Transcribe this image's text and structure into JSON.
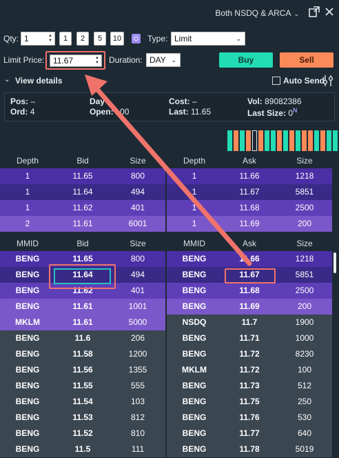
{
  "topbar": {
    "venue_label": "Both NSDQ & ARCA",
    "venue_chevron": "⌄",
    "popout_icon": "popout-icon",
    "close_icon": "close-icon"
  },
  "order": {
    "qty_label": "Qty:",
    "qty_value": "1",
    "qty_presets": [
      "1",
      "2",
      "5",
      "10"
    ],
    "o_badge": "O",
    "type_label": "Type:",
    "type_value": "Limit",
    "limit_label": "Limit Price:",
    "limit_value": "11.67",
    "duration_label": "Duration:",
    "duration_value": "DAY",
    "buy_label": "Buy",
    "sell_label": "Sell",
    "view_details_label": "View details",
    "auto_send_label": "Auto Send",
    "colors": {
      "buy": "#22dcb4",
      "sell": "#fa8a58",
      "highlight": "#f0736b",
      "focus": "#25c5c0"
    }
  },
  "stats": {
    "pos_label": "Pos:",
    "pos_value": "–",
    "ord_label": "Ord:",
    "ord_value": "4",
    "day_label": "Day",
    "day_value": "",
    "open_label": "Open:",
    "open_value": "00",
    "cost_label": "Cost:",
    "cost_value": "–",
    "last_label": "Last:",
    "last_value": "11.65",
    "vol_label": "Vol:",
    "vol_value": "89082386",
    "last_size_label": "Last Size:",
    "last_size_value": "0",
    "last_size_tag": "N"
  },
  "activity_bars": [
    "#22dcb4",
    "#fa8a58",
    "#22dcb4",
    "#fa8a58",
    "#1e2a33",
    "#fa8a58",
    "#22dcb4",
    "#22dcb4",
    "#fa8a58",
    "#22dcb4",
    "#fa8a58",
    "#22dcb4",
    "#fa8a58",
    "#fa8a58",
    "#22dcb4",
    "#fa8a58",
    "#22dcb4",
    "#22dcb4",
    "#fa8a58"
  ],
  "depth": {
    "headers": [
      "Depth",
      "Bid",
      "Size",
      "Depth",
      "Ask",
      "Size"
    ],
    "rows": [
      {
        "bid_depth": "1",
        "bid": "11.65",
        "bid_size": "800",
        "ask_depth": "1",
        "ask": "11.66",
        "ask_size": "1218",
        "color": "#4a2fa6"
      },
      {
        "bid_depth": "1",
        "bid": "11.64",
        "bid_size": "494",
        "ask_depth": "1",
        "ask": "11.67",
        "ask_size": "5851",
        "color": "#3a2a88"
      },
      {
        "bid_depth": "1",
        "bid": "11.62",
        "bid_size": "401",
        "ask_depth": "1",
        "ask": "11.68",
        "ask_size": "2500",
        "color": "#5e3fb8"
      },
      {
        "bid_depth": "2",
        "bid": "11.61",
        "bid_size": "6001",
        "ask_depth": "1",
        "ask": "11.69",
        "ask_size": "200",
        "color": "#7b58c9"
      }
    ]
  },
  "book": {
    "headers": [
      "MMID",
      "Bid",
      "Size",
      "MMID",
      "Ask",
      "Size"
    ],
    "rows": [
      {
        "bid_mmid": "BENG",
        "bid": "11.65",
        "bid_size": "800",
        "bid_color": "#4a2fa6",
        "ask_mmid": "BENG",
        "ask": "11.66",
        "ask_size": "1218",
        "ask_color": "#4a2fa6"
      },
      {
        "bid_mmid": "BENG",
        "bid": "11.64",
        "bid_size": "494",
        "bid_color": "#3a2a88",
        "ask_mmid": "BENG",
        "ask": "11.67",
        "ask_size": "5851",
        "ask_color": "#3a2a88"
      },
      {
        "bid_mmid": "BENG",
        "bid": "11.62",
        "bid_size": "401",
        "bid_color": "#5e3fb8",
        "ask_mmid": "BENG",
        "ask": "11.68",
        "ask_size": "2500",
        "ask_color": "#5e3fb8"
      },
      {
        "bid_mmid": "BENG",
        "bid": "11.61",
        "bid_size": "1001",
        "bid_color": "#7b58c9",
        "ask_mmid": "BENG",
        "ask": "11.69",
        "ask_size": "200",
        "ask_color": "#7b58c9"
      },
      {
        "bid_mmid": "MKLM",
        "bid": "11.61",
        "bid_size": "5000",
        "bid_color": "#7b58c9",
        "ask_mmid": "NSDQ",
        "ask": "11.7",
        "ask_size": "1900",
        "ask_color": "#3a4650"
      },
      {
        "bid_mmid": "BENG",
        "bid": "11.6",
        "bid_size": "206",
        "bid_color": "#3a4650",
        "ask_mmid": "BENG",
        "ask": "11.71",
        "ask_size": "1000",
        "ask_color": "#3a4650"
      },
      {
        "bid_mmid": "BENG",
        "bid": "11.58",
        "bid_size": "1200",
        "bid_color": "#3a4650",
        "ask_mmid": "BENG",
        "ask": "11.72",
        "ask_size": "8230",
        "ask_color": "#3a4650"
      },
      {
        "bid_mmid": "BENG",
        "bid": "11.56",
        "bid_size": "1355",
        "bid_color": "#3a4650",
        "ask_mmid": "MKLM",
        "ask": "11.72",
        "ask_size": "100",
        "ask_color": "#3a4650"
      },
      {
        "bid_mmid": "BENG",
        "bid": "11.55",
        "bid_size": "555",
        "bid_color": "#3a4650",
        "ask_mmid": "BENG",
        "ask": "11.73",
        "ask_size": "512",
        "ask_color": "#3a4650"
      },
      {
        "bid_mmid": "BENG",
        "bid": "11.54",
        "bid_size": "103",
        "bid_color": "#3a4650",
        "ask_mmid": "BENG",
        "ask": "11.75",
        "ask_size": "250",
        "ask_color": "#3a4650"
      },
      {
        "bid_mmid": "BENG",
        "bid": "11.53",
        "bid_size": "812",
        "bid_color": "#3a4650",
        "ask_mmid": "BENG",
        "ask": "11.76",
        "ask_size": "530",
        "ask_color": "#3a4650"
      },
      {
        "bid_mmid": "BENG",
        "bid": "11.52",
        "bid_size": "810",
        "bid_color": "#3a4650",
        "ask_mmid": "BENG",
        "ask": "11.77",
        "ask_size": "640",
        "ask_color": "#3a4650"
      },
      {
        "bid_mmid": "BENG",
        "bid": "11.5",
        "bid_size": "111",
        "bid_color": "#3a4650",
        "ask_mmid": "BENG",
        "ask": "11.78",
        "ask_size": "5019",
        "ask_color": "#3a4650"
      }
    ]
  }
}
